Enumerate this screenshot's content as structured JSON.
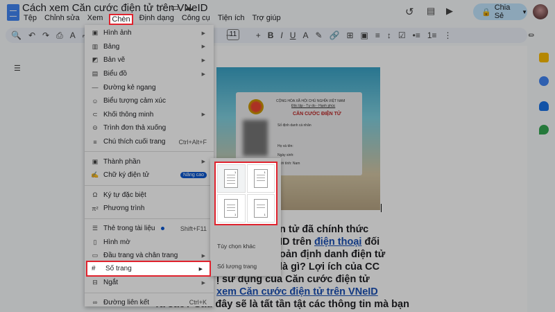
{
  "title": "Cách xem Căn cước điện tử trên VNeID",
  "menubar": [
    "Tệp",
    "Chỉnh sửa",
    "Xem",
    "Chèn",
    "Định dạng",
    "Công cụ",
    "Tiện ích",
    "Trợ giúp"
  ],
  "share_label": "Chia Sẻ",
  "toolbar": {
    "font_size": "11"
  },
  "insert_menu": {
    "items": [
      {
        "label": "Hình ảnh",
        "icon": "image-icon",
        "submenu": true
      },
      {
        "label": "Bảng",
        "icon": "table-icon",
        "submenu": true
      },
      {
        "label": "Bản vẽ",
        "icon": "drawing-icon",
        "submenu": true
      },
      {
        "label": "Biểu đồ",
        "icon": "chart-icon",
        "submenu": true
      },
      {
        "label": "Đường kẻ ngang",
        "icon": "horizontal-line-icon"
      },
      {
        "label": "Biểu tượng cảm xúc",
        "icon": "emoji-icon"
      },
      {
        "label": "Khối thông minh",
        "icon": "smart-chip-icon",
        "submenu": true
      },
      {
        "label": "Trình đơn thả xuống",
        "icon": "dropdown-icon"
      },
      {
        "label": "Chú thích cuối trang",
        "icon": "footnote-icon",
        "shortcut": "Ctrl+Alt+F"
      },
      {
        "label": "Thành phần",
        "icon": "building-blocks-icon",
        "submenu": true
      },
      {
        "label": "Chữ ký điện tử",
        "icon": "signature-icon",
        "badge": "Nâng cao"
      },
      {
        "label": "Ký tự đặc biệt",
        "icon": "omega-icon"
      },
      {
        "label": "Phương trình",
        "icon": "pi-icon"
      },
      {
        "label": "Thẻ trong tài liệu",
        "icon": "tabs-icon",
        "shortcut": "Shift+F11"
      },
      {
        "label": "Hình mờ",
        "icon": "watermark-icon"
      },
      {
        "label": "Đầu trang và chân trang",
        "icon": "header-footer-icon",
        "submenu": true
      },
      {
        "label": "Số trang",
        "icon": "hash-icon",
        "submenu": true
      },
      {
        "label": "Ngắt",
        "icon": "break-icon",
        "submenu": true
      },
      {
        "label": "Đường liên kết",
        "icon": "link-icon",
        "shortcut": "Ctrl+K"
      }
    ]
  },
  "submenu": {
    "more_options": "Tùy chọn khác",
    "page_count": "Số lượng trang"
  },
  "card": {
    "header1": "CỘNG HÒA XÃ HỘI CHỦ NGHĨA VIỆT NAM",
    "header2": "Độc lập - Tự do - Hạnh phúc",
    "title": "CĂN CƯỚC ĐIỆN TỬ",
    "id_label": "Số định danh cá nhân",
    "name_label": "Họ và tên:",
    "dob_label": "Ngày sinh:",
    "sex_label": "Giới tính: Nam"
  },
  "doc_lines": {
    "l1": "n tử đã chính thức",
    "l2a": "ID trên ",
    "l2link": "điện thoại",
    "l2b": " đối",
    "l3": "oản định danh điện tử",
    "l4": "là gì? Lợi ích của CC",
    "l5": "ị sử dụng của Căn cước điện tử",
    "l6link": "xem Căn cước điện tử trên VNeID",
    "l7": "Ta sao? Sau đây sẽ là tất tần tật các thông tin mà bạn"
  },
  "colors": {
    "highlight": "#e0222d",
    "accent": "#0b57d0",
    "share_bg": "#c2e7ff"
  }
}
